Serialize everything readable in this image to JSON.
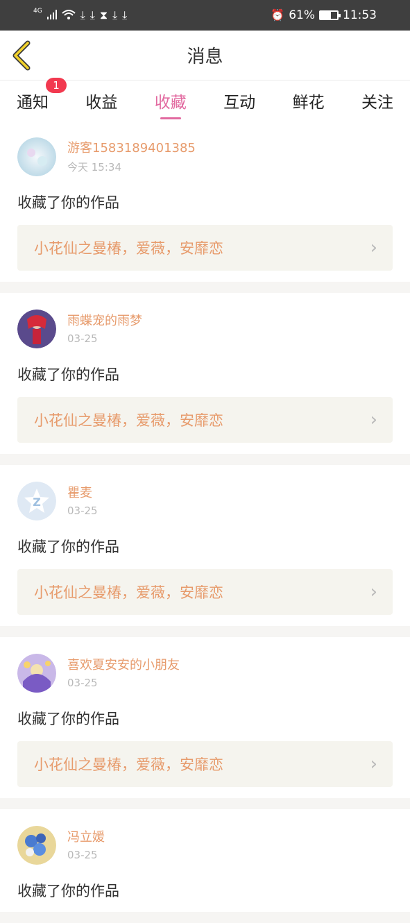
{
  "status_bar": {
    "network": "4G",
    "battery": "61%",
    "battery_level": 0.61,
    "time": "11:53",
    "icons": [
      "signal-icon",
      "wifi-icon",
      "download-icon",
      "download-icon",
      "hourglass-icon",
      "download-icon",
      "download-icon",
      "alarm-icon",
      "battery-icon"
    ]
  },
  "header": {
    "title": "消息",
    "back_icon": "chevron-left-icon"
  },
  "tabs": [
    {
      "label": "通知",
      "badge": "1"
    },
    {
      "label": "收益"
    },
    {
      "label": "收藏",
      "active": true
    },
    {
      "label": "互动"
    },
    {
      "label": "鲜花"
    },
    {
      "label": "关注"
    }
  ],
  "colors": {
    "accent": "#e26aa0",
    "username": "#e79b6c",
    "badge": "#f2394f",
    "card_bg": "#f5f4ee"
  },
  "messages": [
    {
      "user": "游客1583189401385",
      "time": "今天 15:34",
      "action": "收藏了你的作品",
      "work": "小花仙之曼椿，爱薇，安靡恋"
    },
    {
      "user": "雨蝶宠的雨梦",
      "time": "03-25",
      "action": "收藏了你的作品",
      "work": "小花仙之曼椿，爱薇，安靡恋"
    },
    {
      "user": "瞿麦",
      "time": "03-25",
      "action": "收藏了你的作品",
      "work": "小花仙之曼椿，爱薇，安靡恋"
    },
    {
      "user": "喜欢夏安安的小朋友",
      "time": "03-25",
      "action": "收藏了你的作品",
      "work": "小花仙之曼椿，爱薇，安靡恋"
    },
    {
      "user": "冯立媛",
      "time": "03-25",
      "action": "收藏了你的作品"
    }
  ]
}
